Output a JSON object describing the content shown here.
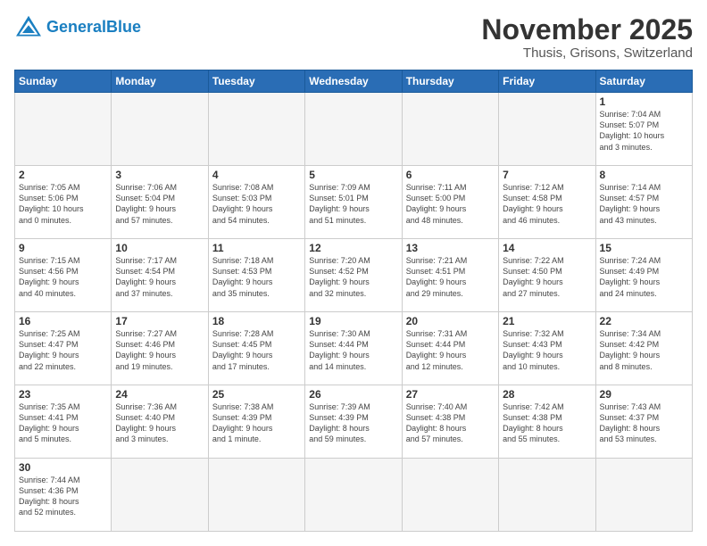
{
  "logo": {
    "text_general": "General",
    "text_blue": "Blue"
  },
  "header": {
    "month": "November 2025",
    "location": "Thusis, Grisons, Switzerland"
  },
  "days_of_week": [
    "Sunday",
    "Monday",
    "Tuesday",
    "Wednesday",
    "Thursday",
    "Friday",
    "Saturday"
  ],
  "weeks": [
    [
      {
        "day": "",
        "info": ""
      },
      {
        "day": "",
        "info": ""
      },
      {
        "day": "",
        "info": ""
      },
      {
        "day": "",
        "info": ""
      },
      {
        "day": "",
        "info": ""
      },
      {
        "day": "",
        "info": ""
      },
      {
        "day": "1",
        "info": "Sunrise: 7:04 AM\nSunset: 5:07 PM\nDaylight: 10 hours\nand 3 minutes."
      }
    ],
    [
      {
        "day": "2",
        "info": "Sunrise: 7:05 AM\nSunset: 5:06 PM\nDaylight: 10 hours\nand 0 minutes."
      },
      {
        "day": "3",
        "info": "Sunrise: 7:06 AM\nSunset: 5:04 PM\nDaylight: 9 hours\nand 57 minutes."
      },
      {
        "day": "4",
        "info": "Sunrise: 7:08 AM\nSunset: 5:03 PM\nDaylight: 9 hours\nand 54 minutes."
      },
      {
        "day": "5",
        "info": "Sunrise: 7:09 AM\nSunset: 5:01 PM\nDaylight: 9 hours\nand 51 minutes."
      },
      {
        "day": "6",
        "info": "Sunrise: 7:11 AM\nSunset: 5:00 PM\nDaylight: 9 hours\nand 48 minutes."
      },
      {
        "day": "7",
        "info": "Sunrise: 7:12 AM\nSunset: 4:58 PM\nDaylight: 9 hours\nand 46 minutes."
      },
      {
        "day": "8",
        "info": "Sunrise: 7:14 AM\nSunset: 4:57 PM\nDaylight: 9 hours\nand 43 minutes."
      }
    ],
    [
      {
        "day": "9",
        "info": "Sunrise: 7:15 AM\nSunset: 4:56 PM\nDaylight: 9 hours\nand 40 minutes."
      },
      {
        "day": "10",
        "info": "Sunrise: 7:17 AM\nSunset: 4:54 PM\nDaylight: 9 hours\nand 37 minutes."
      },
      {
        "day": "11",
        "info": "Sunrise: 7:18 AM\nSunset: 4:53 PM\nDaylight: 9 hours\nand 35 minutes."
      },
      {
        "day": "12",
        "info": "Sunrise: 7:20 AM\nSunset: 4:52 PM\nDaylight: 9 hours\nand 32 minutes."
      },
      {
        "day": "13",
        "info": "Sunrise: 7:21 AM\nSunset: 4:51 PM\nDaylight: 9 hours\nand 29 minutes."
      },
      {
        "day": "14",
        "info": "Sunrise: 7:22 AM\nSunset: 4:50 PM\nDaylight: 9 hours\nand 27 minutes."
      },
      {
        "day": "15",
        "info": "Sunrise: 7:24 AM\nSunset: 4:49 PM\nDaylight: 9 hours\nand 24 minutes."
      }
    ],
    [
      {
        "day": "16",
        "info": "Sunrise: 7:25 AM\nSunset: 4:47 PM\nDaylight: 9 hours\nand 22 minutes."
      },
      {
        "day": "17",
        "info": "Sunrise: 7:27 AM\nSunset: 4:46 PM\nDaylight: 9 hours\nand 19 minutes."
      },
      {
        "day": "18",
        "info": "Sunrise: 7:28 AM\nSunset: 4:45 PM\nDaylight: 9 hours\nand 17 minutes."
      },
      {
        "day": "19",
        "info": "Sunrise: 7:30 AM\nSunset: 4:44 PM\nDaylight: 9 hours\nand 14 minutes."
      },
      {
        "day": "20",
        "info": "Sunrise: 7:31 AM\nSunset: 4:44 PM\nDaylight: 9 hours\nand 12 minutes."
      },
      {
        "day": "21",
        "info": "Sunrise: 7:32 AM\nSunset: 4:43 PM\nDaylight: 9 hours\nand 10 minutes."
      },
      {
        "day": "22",
        "info": "Sunrise: 7:34 AM\nSunset: 4:42 PM\nDaylight: 9 hours\nand 8 minutes."
      }
    ],
    [
      {
        "day": "23",
        "info": "Sunrise: 7:35 AM\nSunset: 4:41 PM\nDaylight: 9 hours\nand 5 minutes."
      },
      {
        "day": "24",
        "info": "Sunrise: 7:36 AM\nSunset: 4:40 PM\nDaylight: 9 hours\nand 3 minutes."
      },
      {
        "day": "25",
        "info": "Sunrise: 7:38 AM\nSunset: 4:39 PM\nDaylight: 9 hours\nand 1 minute."
      },
      {
        "day": "26",
        "info": "Sunrise: 7:39 AM\nSunset: 4:39 PM\nDaylight: 8 hours\nand 59 minutes."
      },
      {
        "day": "27",
        "info": "Sunrise: 7:40 AM\nSunset: 4:38 PM\nDaylight: 8 hours\nand 57 minutes."
      },
      {
        "day": "28",
        "info": "Sunrise: 7:42 AM\nSunset: 4:38 PM\nDaylight: 8 hours\nand 55 minutes."
      },
      {
        "day": "29",
        "info": "Sunrise: 7:43 AM\nSunset: 4:37 PM\nDaylight: 8 hours\nand 53 minutes."
      }
    ],
    [
      {
        "day": "30",
        "info": "Sunrise: 7:44 AM\nSunset: 4:36 PM\nDaylight: 8 hours\nand 52 minutes."
      },
      {
        "day": "",
        "info": ""
      },
      {
        "day": "",
        "info": ""
      },
      {
        "day": "",
        "info": ""
      },
      {
        "day": "",
        "info": ""
      },
      {
        "day": "",
        "info": ""
      },
      {
        "day": "",
        "info": ""
      }
    ]
  ]
}
